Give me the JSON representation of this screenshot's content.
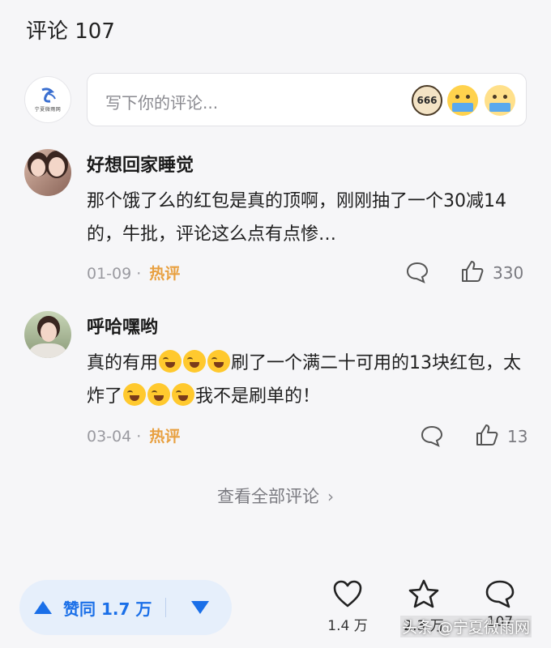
{
  "header": {
    "title": "评论 107"
  },
  "compose": {
    "placeholder": "写下你的评论...",
    "self_avatar_text": "宁夏微雨网",
    "stickers": [
      "666",
      "face-sticker-1",
      "face-sticker-2"
    ]
  },
  "comments": [
    {
      "username": "好想回家睡觉",
      "text": "那个饿了么的红包是真的顶啊，刚刚抽了一个30减14的，牛批，评论这么点有点惨…",
      "date": "01-09",
      "separator": "·",
      "badge": "热评",
      "likes": "330"
    },
    {
      "username": "呼哈嘿哟",
      "text_parts": [
        "真的有用",
        "刷了一个满二十可用的13块红包，太炸了",
        "我不是刷单的！"
      ],
      "emoji_name": "laughing-crying-emoji",
      "date": "03-04",
      "separator": "·",
      "badge": "热评",
      "likes": "13"
    }
  ],
  "view_all": {
    "label": "查看全部评论",
    "chevron": "›"
  },
  "bottom_bar": {
    "vote_label": "赞同 1.7 万",
    "favorite_count": "1.4 万",
    "collect_count": "2.3 万",
    "comment_count": "107"
  },
  "watermark": "头条 @宁夏微雨网",
  "colors": {
    "accent": "#1a6fe8",
    "hot_badge": "#e8a040",
    "background": "#f6f6f8"
  }
}
